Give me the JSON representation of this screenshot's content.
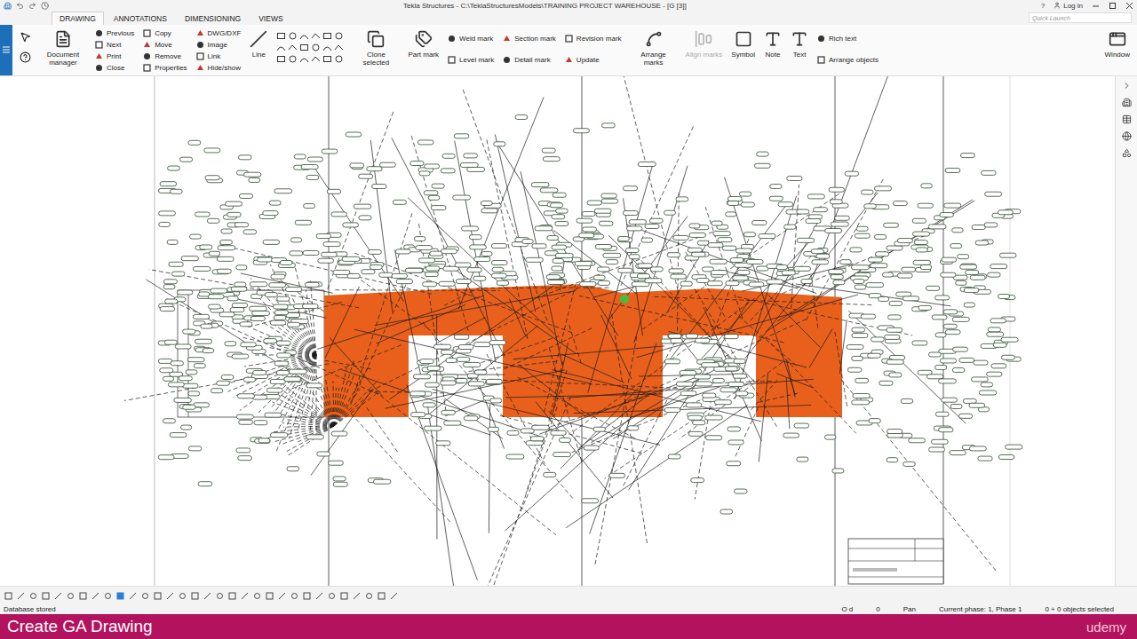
{
  "window": {
    "title": "Tekla Structures - C:\\TeklaStructuresModels\\TRAINING PROJECT WAREHOUSE  - [G  [3]]",
    "help": "?",
    "login": "Log in"
  },
  "tabs": [
    {
      "label": "DRAWING",
      "selected": true
    },
    {
      "label": "ANNOTATIONS",
      "selected": false
    },
    {
      "label": "DIMENSIONING",
      "selected": false
    },
    {
      "label": "VIEWS",
      "selected": false
    }
  ],
  "quick_launch": {
    "placeholder": "Quick Launch"
  },
  "ribbon": [
    {
      "kind": "large",
      "label": "Document manager",
      "disabled": false
    },
    {
      "kind": "stack",
      "items": [
        "Previous",
        "Next",
        "Print",
        "Close"
      ]
    },
    {
      "kind": "stack",
      "items": [
        "Copy",
        "Move",
        "Remove",
        "Properties"
      ]
    },
    {
      "kind": "stack",
      "items": [
        "DWG/DXF",
        "Image",
        "Link",
        "Hide/show"
      ]
    },
    {
      "kind": "large",
      "label": "Line",
      "disabled": false
    },
    {
      "kind": "shapes"
    },
    {
      "kind": "large",
      "label": "Clone selected",
      "disabled": false
    },
    {
      "kind": "large",
      "label": "Part mark",
      "disabled": false
    },
    {
      "kind": "stack",
      "items": [
        "Weld mark",
        "Level mark"
      ]
    },
    {
      "kind": "stack",
      "items": [
        "Section mark",
        "Detail mark"
      ]
    },
    {
      "kind": "stack",
      "items": [
        "Revision mark",
        "Update"
      ]
    },
    {
      "kind": "large",
      "label": "Arrange marks",
      "disabled": false
    },
    {
      "kind": "large",
      "label": "Align marks",
      "disabled": true
    },
    {
      "kind": "large",
      "label": "Symbol",
      "disabled": false
    },
    {
      "kind": "large",
      "label": "Note",
      "disabled": false
    },
    {
      "kind": "large",
      "label": "Text",
      "disabled": false
    },
    {
      "kind": "stack",
      "items": [
        "Rich text",
        "Arrange objects"
      ]
    },
    {
      "kind": "large",
      "label": "Window",
      "disabled": false
    }
  ],
  "status_bar": {
    "message": "Database stored",
    "fields": [
      "O d",
      "0",
      "Pan",
      "Current phase: 1, Phase 1",
      "0 + 0 objects selected"
    ]
  },
  "caption": {
    "title": "Create GA Drawing",
    "brand": "udemy"
  }
}
